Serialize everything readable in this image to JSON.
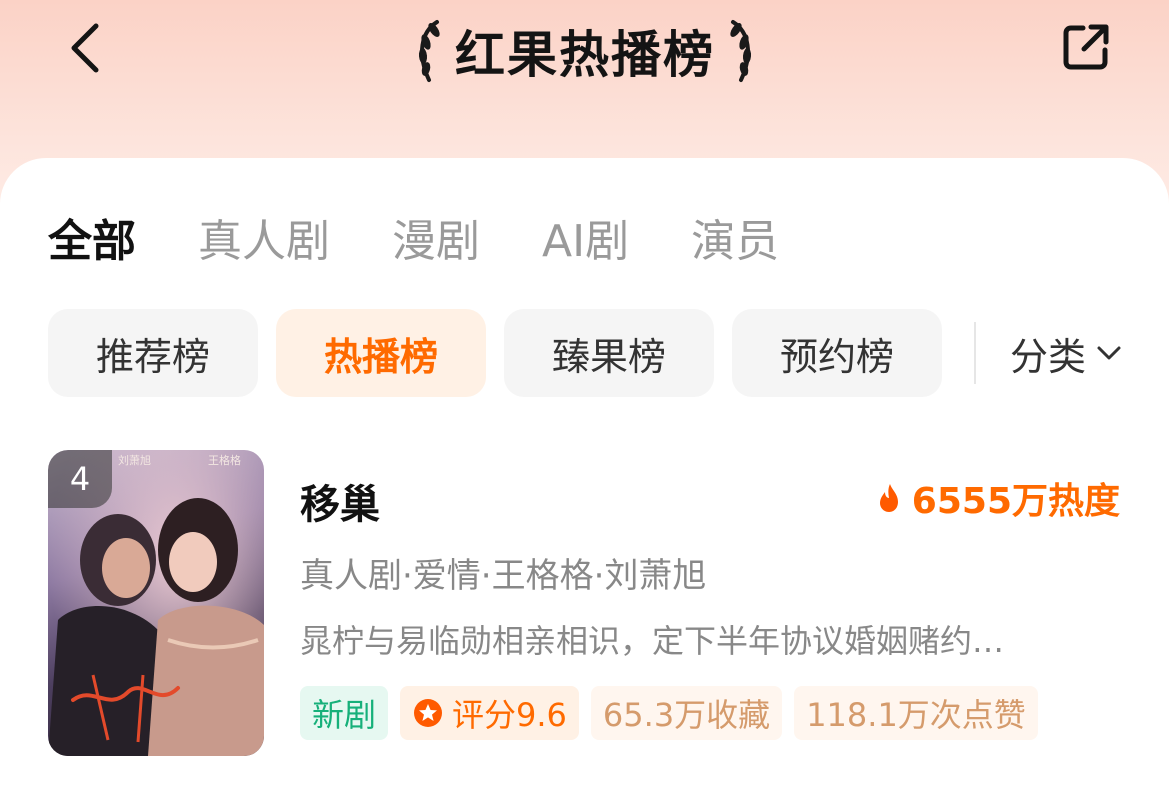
{
  "header": {
    "title": "红果热播榜",
    "back_icon": "chevron-left-icon",
    "share_icon": "share-icon"
  },
  "tabs": [
    {
      "label": "全部",
      "active": true
    },
    {
      "label": "真人剧",
      "active": false
    },
    {
      "label": "漫剧",
      "active": false
    },
    {
      "label": "AI剧",
      "active": false
    },
    {
      "label": "演员",
      "active": false
    }
  ],
  "rank_chips": [
    {
      "label": "推荐榜",
      "active": false
    },
    {
      "label": "热播榜",
      "active": true
    },
    {
      "label": "臻果榜",
      "active": false
    },
    {
      "label": "预约榜",
      "active": false
    }
  ],
  "category": {
    "label": "分类"
  },
  "list": [
    {
      "rank": "4",
      "title": "移巢",
      "heat": "6555万热度",
      "meta": "真人剧·爱情·王格格·刘萧旭",
      "description": "晁柠与易临勋相亲相识，定下半年协议婚姻赌约…",
      "tags": {
        "new": "新剧",
        "rating": "评分9.6",
        "favorites": "65.3万收藏",
        "likes": "118.1万次点赞"
      }
    }
  ],
  "colors": {
    "accent": "#ff6a00",
    "green_tag": "#17b07a",
    "muted_text": "#888888"
  }
}
